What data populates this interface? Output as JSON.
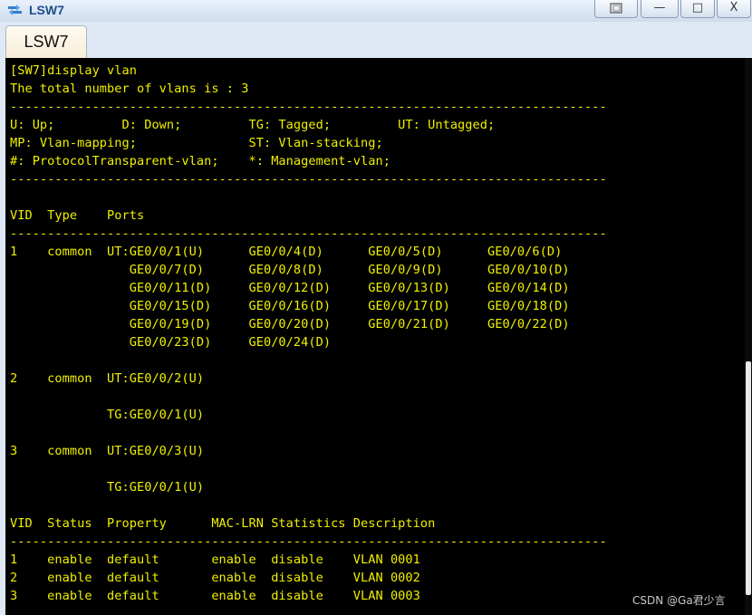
{
  "window": {
    "title": "LSW7",
    "controls": {
      "restore": "",
      "minimize": "—",
      "maximize": "□",
      "close": "X"
    },
    "icon": "switch-app-icon"
  },
  "tabs": [
    {
      "label": "LSW7"
    }
  ],
  "terminal": {
    "lines": [
      "[SW7]dis",
      "[SW7]display vlan",
      "The total number of vlans is : 3",
      "--------------------------------------------------------------------------------",
      "U: Up;         D: Down;         TG: Tagged;         UT: Untagged;",
      "MP: Vlan-mapping;               ST: Vlan-stacking;",
      "#: ProtocolTransparent-vlan;    *: Management-vlan;",
      "--------------------------------------------------------------------------------",
      "",
      "VID  Type    Ports",
      "--------------------------------------------------------------------------------",
      "1    common  UT:GE0/0/1(U)      GE0/0/4(D)      GE0/0/5(D)      GE0/0/6(D)",
      "                GE0/0/7(D)      GE0/0/8(D)      GE0/0/9(D)      GE0/0/10(D)",
      "                GE0/0/11(D)     GE0/0/12(D)     GE0/0/13(D)     GE0/0/14(D)",
      "                GE0/0/15(D)     GE0/0/16(D)     GE0/0/17(D)     GE0/0/18(D)",
      "                GE0/0/19(D)     GE0/0/20(D)     GE0/0/21(D)     GE0/0/22(D)",
      "                GE0/0/23(D)     GE0/0/24(D)",
      "",
      "2    common  UT:GE0/0/2(U)",
      "",
      "             TG:GE0/0/1(U)",
      "",
      "3    common  UT:GE0/0/3(U)",
      "",
      "             TG:GE0/0/1(U)",
      "",
      "VID  Status  Property      MAC-LRN Statistics Description",
      "--------------------------------------------------------------------------------",
      "1    enable  default       enable  disable    VLAN 0001",
      "2    enable  default       enable  disable    VLAN 0002",
      "3    enable  default       enable  disable    VLAN 0003"
    ],
    "text_color": "#f0f000",
    "background": "#000000"
  },
  "watermark": "CSDN @Ga君少言"
}
